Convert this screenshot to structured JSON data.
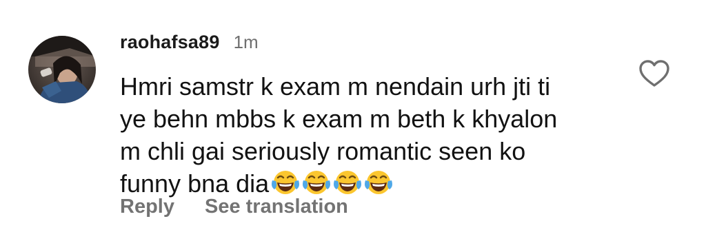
{
  "comment": {
    "username": "raohafsa89",
    "timestamp": "1m",
    "text_lines": [
      "Hmri samstr k exam m nendain urh jti ti",
      "ye behn mbbs k exam m beth k khyalon",
      "m chli gai seriously romantic seen ko",
      "funny bna dia"
    ],
    "emojis": [
      "face-with-tears-of-joy",
      "face-with-tears-of-joy",
      "face-with-tears-of-joy",
      "face-with-tears-of-joy"
    ],
    "reply_label": "Reply",
    "translate_label": "See translation",
    "like_icon": "heart-outline-icon",
    "colors": {
      "username": "#1b1b1b",
      "timestamp": "#6f6f6f",
      "action": "#737373",
      "text": "#121212"
    }
  }
}
